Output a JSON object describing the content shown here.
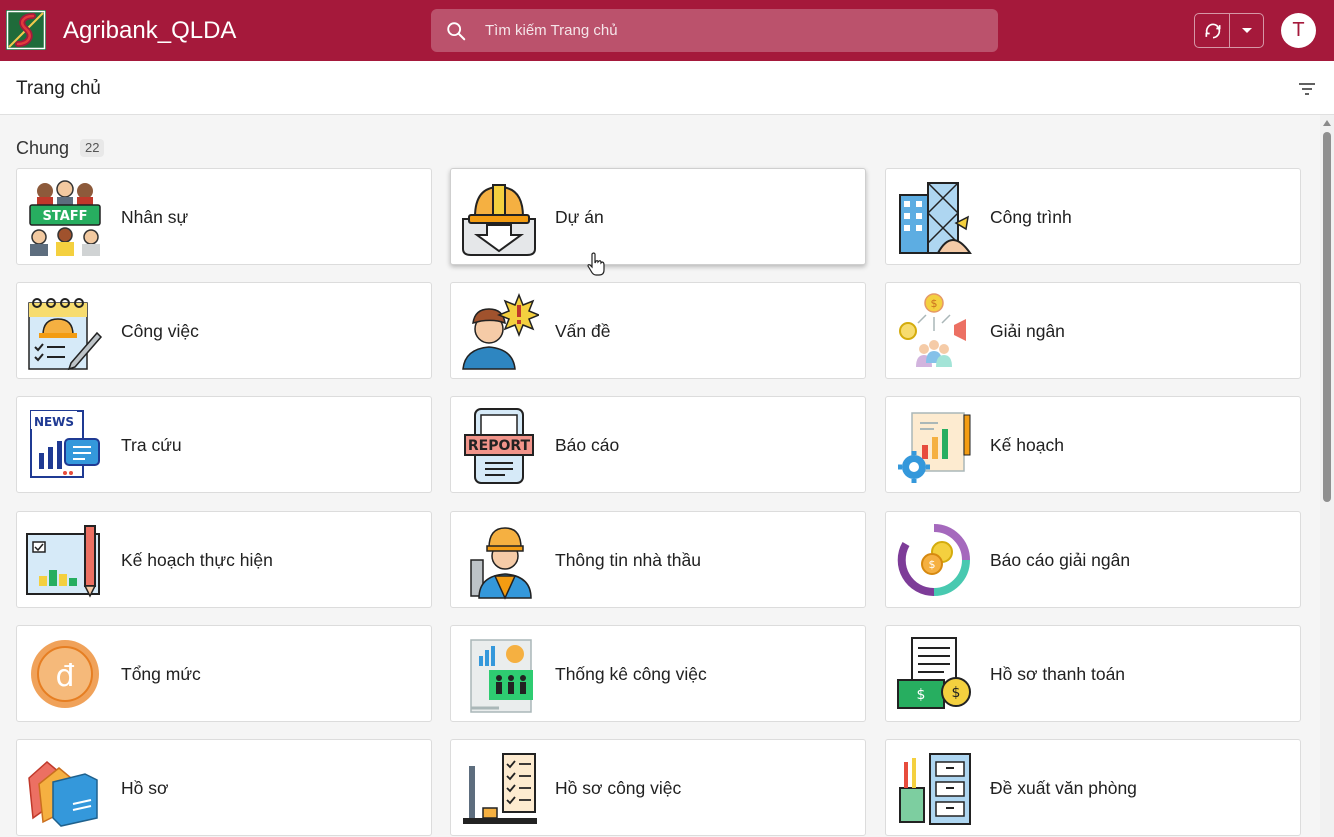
{
  "header": {
    "app_title": "Agribank_QLDA",
    "search_placeholder": "Tìm kiếm Trang chủ",
    "avatar_initial": "T",
    "brand_color": "#a5193b"
  },
  "subheader": {
    "page_title": "Trang chủ"
  },
  "section": {
    "title": "Chung",
    "count": "22"
  },
  "cards": [
    {
      "label": "Nhân sự",
      "icon": "staff-icon"
    },
    {
      "label": "Dự án",
      "icon": "project-helmet-icon"
    },
    {
      "label": "Công trình",
      "icon": "construction-building-icon"
    },
    {
      "label": "Công việc",
      "icon": "task-clipboard-icon"
    },
    {
      "label": "Vấn đề",
      "icon": "issue-worker-icon"
    },
    {
      "label": "Giải ngân",
      "icon": "disbursement-icon"
    },
    {
      "label": "Tra cứu",
      "icon": "news-lookup-icon"
    },
    {
      "label": "Báo cáo",
      "icon": "report-icon"
    },
    {
      "label": "Kế hoạch",
      "icon": "plan-gear-icon"
    },
    {
      "label": "Kế hoạch thực hiện",
      "icon": "blueprint-plan-icon"
    },
    {
      "label": "Thông tin nhà thầu",
      "icon": "contractor-icon"
    },
    {
      "label": "Báo cáo giải ngân",
      "icon": "disbursement-report-icon"
    },
    {
      "label": "Tổng mức",
      "icon": "dong-coin-icon"
    },
    {
      "label": "Thống kê công việc",
      "icon": "work-statistics-icon"
    },
    {
      "label": "Hồ sơ thanh toán",
      "icon": "payment-document-icon"
    },
    {
      "label": "Hồ sơ",
      "icon": "folders-icon"
    },
    {
      "label": "Hồ sơ công việc",
      "icon": "work-document-icon"
    },
    {
      "label": "Đề xuất văn phòng",
      "icon": "office-supplies-icon"
    }
  ]
}
